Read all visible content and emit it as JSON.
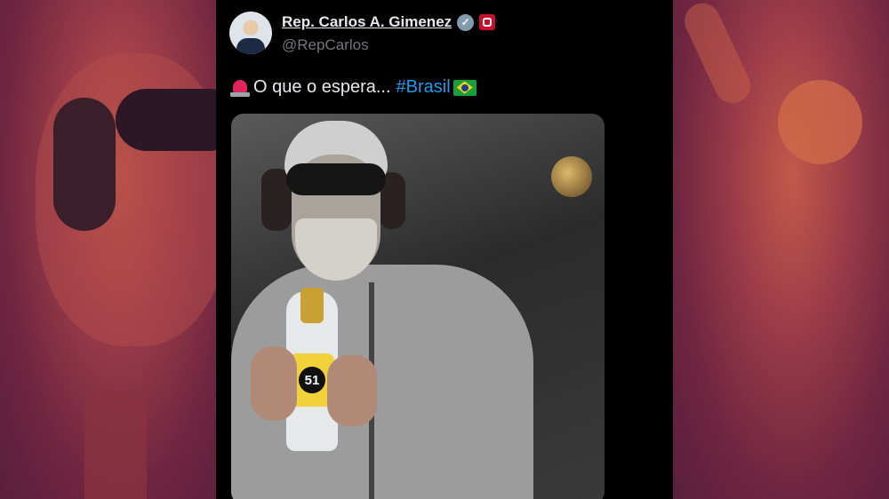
{
  "tweet": {
    "display_name": "Rep. Carlos A. Gimenez",
    "handle": "@RepCarlos",
    "text": "O que o espera...",
    "hashtag": "#Brasil",
    "icons": {
      "verified": "verified-badge-icon",
      "affiliation": "government-affiliation-icon",
      "siren": "siren-emoji-icon",
      "flag": "brazil-flag-emoji-icon"
    }
  },
  "photo": {
    "label_number": "51"
  },
  "colors": {
    "background_side": "#6e2a3a",
    "tweet_background": "#000000",
    "name_text": "#e7e9ea",
    "handle_text": "#71767b",
    "hashtag": "#1d9bf0",
    "verified_badge": "#829aab"
  }
}
